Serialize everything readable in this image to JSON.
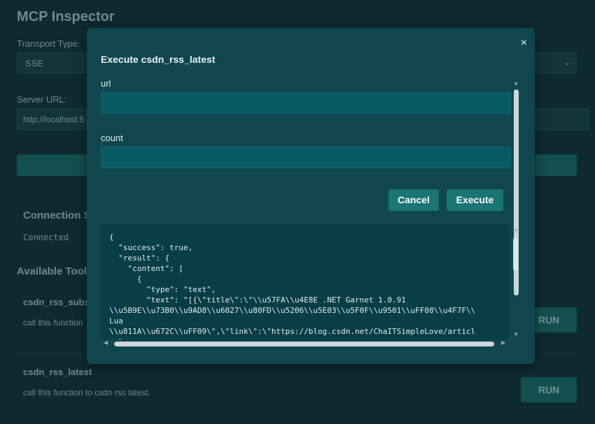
{
  "app": {
    "title": "MCP Inspector"
  },
  "connection_form": {
    "transport_label": "Transport Type:",
    "transport_value": "SSE",
    "server_url_label": "Server URL:",
    "server_url_value": "http://localhost:5"
  },
  "connection_status": {
    "title": "Connection S",
    "status": "Connected"
  },
  "tools": {
    "title": "Available Tool",
    "items": [
      {
        "name": "csdn_rss_subsc",
        "description": "call this function",
        "run_label": "RUN"
      },
      {
        "name": "csdn_rss_latest",
        "description": "call this function to csdn rss latest.",
        "run_label": "RUN"
      }
    ]
  },
  "modal": {
    "close_glyph": "×",
    "title": "Execute csdn_rss_latest",
    "fields": [
      {
        "label": "url",
        "value": ""
      },
      {
        "label": "count",
        "value": ""
      }
    ],
    "cancel_label": "Cancel",
    "execute_label": "Execute",
    "result_text": "{\n  \"success\": true,\n  \"result\": {\n    \"content\": [\n      {\n        \"type\": \"text\",\n        \"text\": \"[{\\\"title\\\":\\\"\\\\u57FA\\\\u4E8E .NET Garnet 1.0.91\n\\\\u5B9E\\\\u73B0\\\\u9AD8\\\\u6027\\\\u80FD\\\\u5206\\\\u5E03\\\\u5F0F\\\\u9501\\\\uFF08\\\\u4F7F\\\\\nLua\n\\\\u811A\\\\u672C\\\\uFF09\\\",\\\"link\\\":\\\"https://blog.csdn.net/ChaITSimpleLove/articl\n  }"
  },
  "icons": {
    "chevron": "chevron-down-icon",
    "close": "close-icon"
  }
}
